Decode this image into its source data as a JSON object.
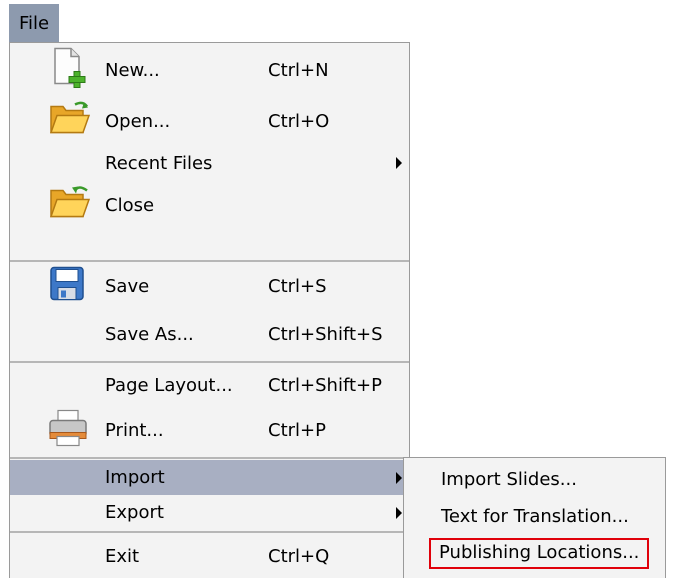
{
  "menubar": {
    "file_label": "File"
  },
  "file_menu": {
    "items": [
      {
        "label": "New...",
        "shortcut": "Ctrl+N",
        "icon": "new-file-icon"
      },
      {
        "label": "Open...",
        "shortcut": "Ctrl+O",
        "icon": "open-folder-icon"
      },
      {
        "label": "Recent Files",
        "shortcut": "",
        "icon": "",
        "submenu": true
      },
      {
        "label": "Close",
        "shortcut": "",
        "icon": "close-folder-icon"
      },
      {
        "label": "Save",
        "shortcut": "Ctrl+S",
        "icon": "save-disk-icon"
      },
      {
        "label": "Save As...",
        "shortcut": "Ctrl+Shift+S",
        "icon": ""
      },
      {
        "label": "Page Layout...",
        "shortcut": "Ctrl+Shift+P",
        "icon": ""
      },
      {
        "label": "Print...",
        "shortcut": "Ctrl+P",
        "icon": "printer-icon"
      },
      {
        "label": "Import",
        "shortcut": "",
        "icon": "",
        "submenu": true,
        "active": true
      },
      {
        "label": "Export",
        "shortcut": "",
        "icon": "",
        "submenu": true
      },
      {
        "label": "Exit",
        "shortcut": "Ctrl+Q",
        "icon": ""
      }
    ]
  },
  "import_submenu": {
    "items": [
      {
        "label": "Import Slides..."
      },
      {
        "label": "Text for Translation..."
      },
      {
        "label": "Publishing Locations...",
        "highlighted": true
      }
    ]
  },
  "colors": {
    "menu_background": "#f3f3f3",
    "active_item": "#a8afc2",
    "menubar_file": "#8d9aae",
    "highlight_box": "#e0000a"
  }
}
